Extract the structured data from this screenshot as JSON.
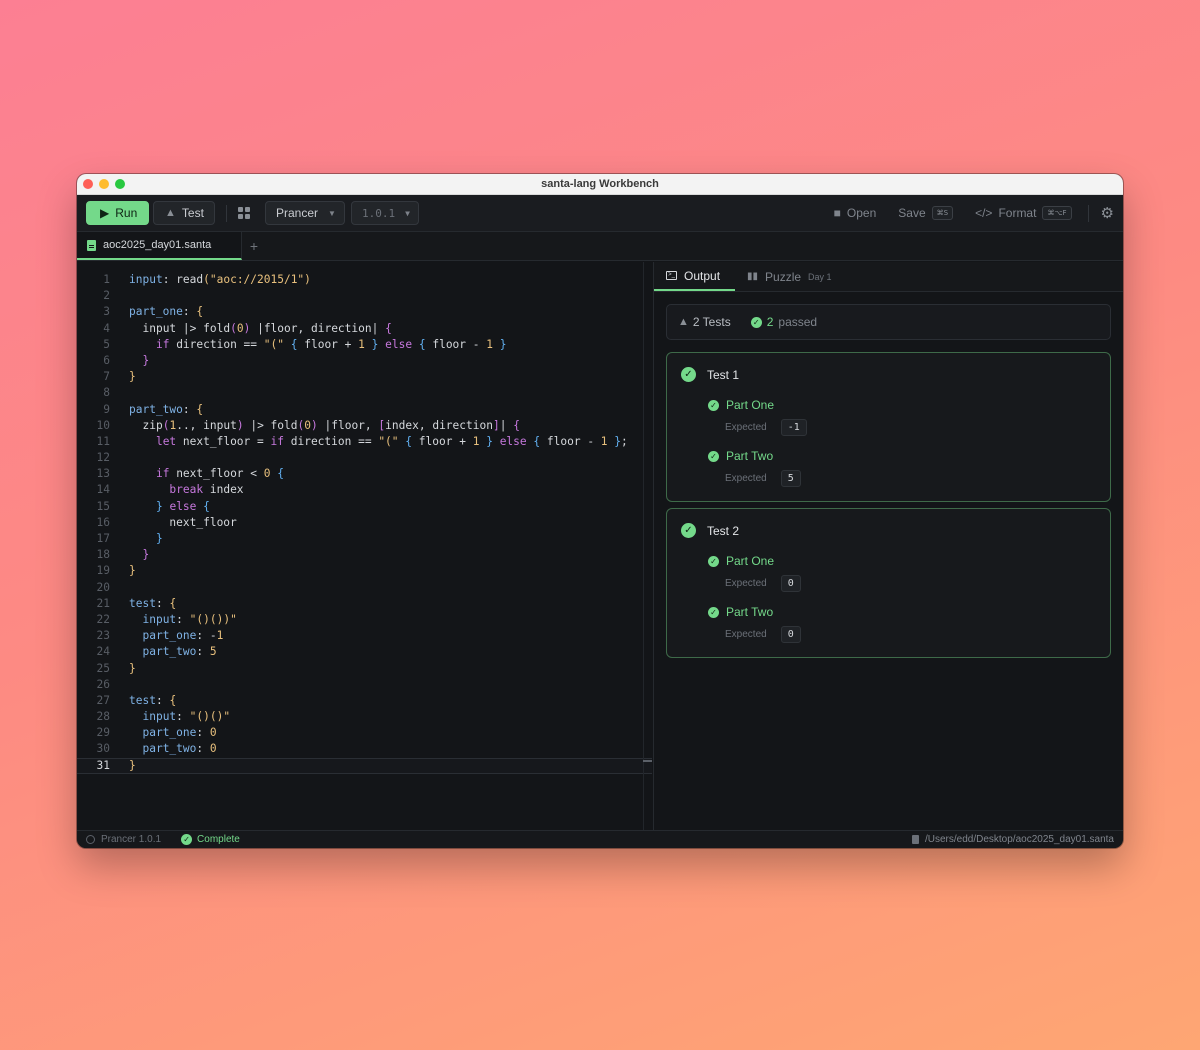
{
  "window": {
    "title": "santa-lang Workbench"
  },
  "toolbar": {
    "run_label": "Run",
    "test_label": "Test",
    "implementation": "Prancer",
    "version": "1.0.1",
    "open_label": "Open",
    "save_label": "Save",
    "save_shortcut": "⌘S",
    "format_label": "Format",
    "format_shortcut": "⌘⌥F"
  },
  "editor": {
    "file_tab": "aoc2025_day01.santa",
    "current_line": 31
  },
  "output": {
    "tabs": [
      {
        "label": "Output"
      },
      {
        "label": "Puzzle",
        "badge": "Day 1"
      }
    ],
    "summary": {
      "tests_label": "2 Tests",
      "passed_count": "2",
      "passed_label": "passed"
    },
    "tests": [
      {
        "name": "Test 1",
        "parts": [
          {
            "label": "Part One",
            "expected_label": "Expected",
            "expected": "-1"
          },
          {
            "label": "Part Two",
            "expected_label": "Expected",
            "expected": "5"
          }
        ]
      },
      {
        "name": "Test 2",
        "parts": [
          {
            "label": "Part One",
            "expected_label": "Expected",
            "expected": "0"
          },
          {
            "label": "Part Two",
            "expected_label": "Expected",
            "expected": "0"
          }
        ]
      }
    ]
  },
  "statusbar": {
    "implementation": "Prancer 1.0.1",
    "status": "Complete",
    "path": "/Users/edd/Desktop/aoc2025_day01.santa"
  },
  "colors": {
    "accent": "#74d98a",
    "background": "#131518"
  },
  "code_lines": [
    "input: read(\"aoc://2015/1\")",
    "",
    "part_one: {",
    "  input |> fold(0) |floor, direction| {",
    "    if direction == \"(\" { floor + 1 } else { floor - 1 }",
    "  }",
    "}",
    "",
    "part_two: {",
    "  zip(1.., input) |> fold(0) |floor, [index, direction]| {",
    "    let next_floor = if direction == \"(\" { floor + 1 } else { floor - 1 };",
    "",
    "    if next_floor < 0 {",
    "      break index",
    "    } else {",
    "      next_floor",
    "    }",
    "  }",
    "}",
    "",
    "test: {",
    "  input: \"()())\"",
    "  part_one: -1",
    "  part_two: 5",
    "}",
    "",
    "test: {",
    "  input: \"()()\"",
    "  part_one: 0",
    "  part_two: 0",
    "}"
  ]
}
